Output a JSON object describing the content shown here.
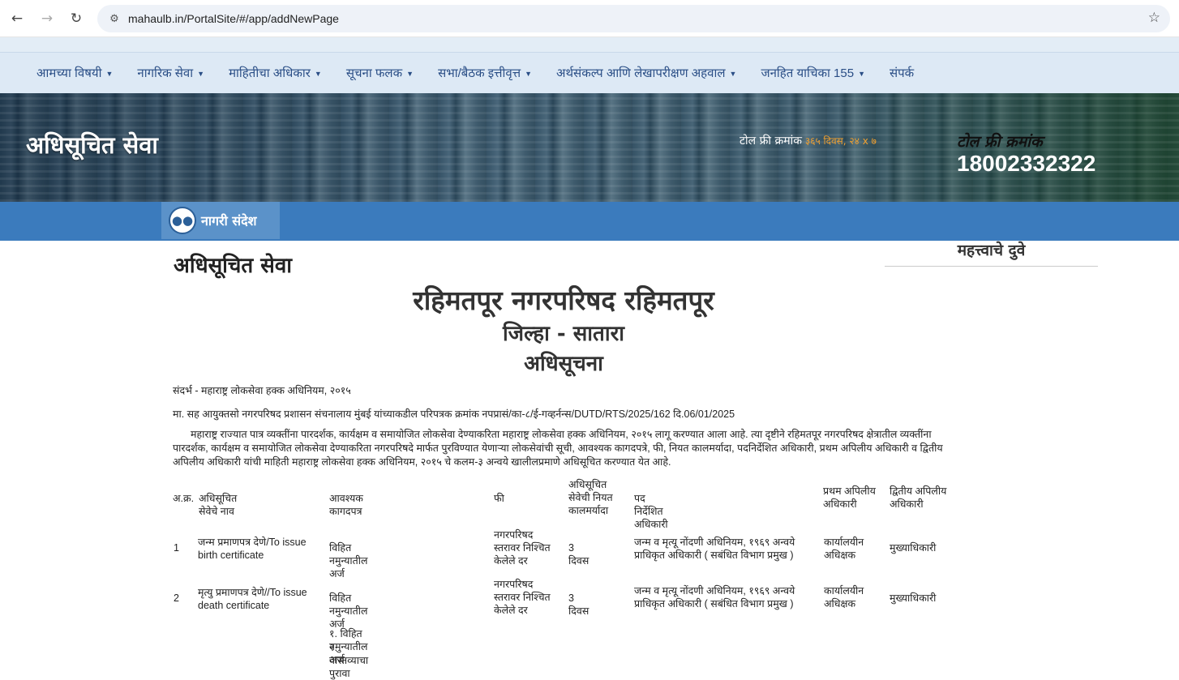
{
  "browser": {
    "url": "mahaulb.in/PortalSite/#/app/addNewPage"
  },
  "nav": {
    "items": [
      {
        "label": "आमच्या विषयी",
        "caret": true
      },
      {
        "label": "नागरिक सेवा",
        "caret": true
      },
      {
        "label": "माहितीचा अधिकार",
        "caret": true
      },
      {
        "label": "सूचना फलक",
        "caret": true
      },
      {
        "label": "सभा/बैठक इत्तीवृत्त",
        "caret": true
      },
      {
        "label": "अर्थसंकल्प आणि लेखापरीक्षण अहवाल",
        "caret": true
      },
      {
        "label": "जनहित याचिका 155",
        "caret": true
      },
      {
        "label": "संपर्क",
        "caret": false
      }
    ]
  },
  "banner": {
    "title": "अधिसूचित सेवा",
    "toll_small_label": "टोल फ्री क्रमांक",
    "toll_small_hours": "३६५ दिवस, २४ x ७",
    "toll_label": "टोल फ्री क्रमांक",
    "toll_number": "18002332322"
  },
  "sandesh": {
    "label": "नागरी संदेश"
  },
  "main": {
    "page_heading": "अधिसूचित सेवा",
    "important_links": "महत्त्वाचे दुवे",
    "council": "रहिमतपूर नगरपरिषद रहिमतपूर",
    "district": "जिल्हा - सातारा",
    "notice": "अधिसूचना",
    "ref1": "संदर्भ -  महाराष्ट्र लोकसेवा हक्क अधिनियम, २०१५",
    "ref2": "मा. सह आयुक्तसो नगरपरिषद प्रशासन संचनालाय मुंबई यांच्याकडील परिपत्रक क्रमांक नपप्रासं/का-८/ई-गव्हर्नन्स/DUTD/RTS/2025/162 दि.06/01/2025",
    "para": "महाराष्ट्र राज्यात पात्र व्यक्तींना पारदर्शक, कार्यक्षम व समायोजित लोकसेवा देण्याकरिता महाराष्ट्र लोकसेवा हक्क अधिनियम, २०१५ लागू करण्यात आला आहे. त्या दृष्टीने रहिमतपूर नगरपरिषद क्षेत्रातील व्यक्तींना पारदर्शक, कार्यक्षम व समायोजित लोकसेवा देण्याकरिता नगरपरिषदे मार्फत पुरविण्यात येणाऱ्या लोकसेवांची सूची, आवश्यक कागदपत्रे, फी, नियत कालमर्यादा, पदनिर्देशित अधिकारी, प्रथम अपिलीय अधिकारी व द्वितीय  अपिलीय अधिकारी यांची माहिती महाराष्ट्र लोकसेवा हक्क अधिनियम, २०१५ चे कलम-३ अन्वये खालीलप्रमाणे अधिसूचित करण्यात येत आहे."
  },
  "table": {
    "headers": {
      "no": "अ.क्र.",
      "service": "अधिसूचित सेवेचे नाव",
      "docs": "आवश्यक कागदपत्र",
      "fee": "फी",
      "time": "अधिसूचित सेवेची नियत कालमर्यादा",
      "officer": "पद निर्देशित अधिकारी",
      "appeal1": "प्रथम अपिलीय अधिकारी",
      "appeal2": "द्वितीय अपिलीय अधिकारी"
    },
    "rows": [
      {
        "no": "1",
        "service": "जन्म प्रमाणपत्र देणे/To issue birth certificate",
        "docs": "विहित नमुन्यातील अर्ज",
        "fee": "नगरपरिषद स्तरावर निश्चित केलेले दर",
        "time": "3 दिवस",
        "officer": "जन्म व मृत्यू नोंदणी अधिनियम, १९६९ अन्वये प्राधिकृत अधिकारी ( सबंधित विभाग प्रमुख )",
        "appeal1": "कार्यालयीन अधिक्षक",
        "appeal2": "मुख्याधिकारी"
      },
      {
        "no": "2",
        "service": "मृत्यु प्रमाणपत्र देणे//To issue death certificate",
        "docs": "विहित नमुन्यातील अर्ज",
        "fee": "नगरपरिषद स्तरावर निश्चित केलेले दर",
        "time": "3 दिवस",
        "officer": "जन्म व मृत्यू नोंदणी अधिनियम, १९६९ अन्वये प्राधिकृत अधिकारी ( सबंधित विभाग प्रमुख )",
        "appeal1": "कार्यालयीन अधिक्षक",
        "appeal2": "मुख्याधिकारी"
      },
      {
        "docs_lines": [
          "१. विहित नमुन्यातील अर्ज",
          "२. वास्तव्याचा पुरावा"
        ]
      }
    ]
  }
}
